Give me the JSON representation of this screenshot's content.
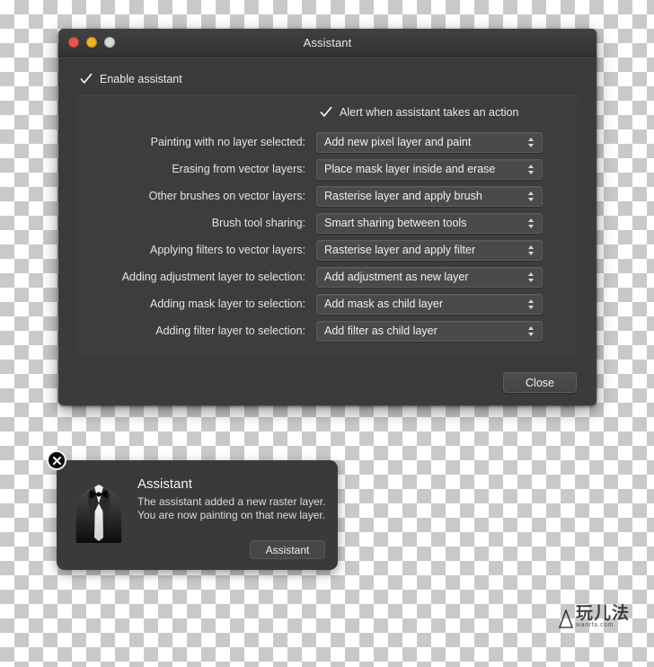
{
  "window": {
    "title": "Assistant",
    "traffic_lights": {
      "close": "close-button",
      "minimize": "minimize-button",
      "zoom": "zoom-button"
    },
    "enable_checkbox": {
      "label": "Enable assistant",
      "checked": true
    },
    "alert_checkbox": {
      "label": "Alert when assistant takes an action",
      "checked": true
    },
    "settings": [
      {
        "label": "Painting with no layer selected:",
        "value": "Add new pixel layer and paint"
      },
      {
        "label": "Erasing from vector layers:",
        "value": "Place mask layer inside and erase"
      },
      {
        "label": "Other brushes on vector layers:",
        "value": "Rasterise layer and apply brush"
      },
      {
        "label": "Brush tool sharing:",
        "value": "Smart sharing between tools"
      },
      {
        "label": "Applying filters to vector layers:",
        "value": "Rasterise layer and apply filter"
      },
      {
        "label": "Adding adjustment layer to selection:",
        "value": "Add adjustment as new layer"
      },
      {
        "label": "Adding mask layer to selection:",
        "value": "Add mask as child layer"
      },
      {
        "label": "Adding filter layer to selection:",
        "value": "Add filter as child layer"
      }
    ],
    "close_button": "Close"
  },
  "toast": {
    "title": "Assistant",
    "line1": "The assistant added a new raster layer.",
    "line2": "You are now painting on that new layer.",
    "button": "Assistant",
    "close_icon": "close-icon",
    "avatar_icon": "tuxedo-icon"
  },
  "watermark": {
    "text": "玩儿法",
    "url": "wanrfa.com"
  },
  "colors": {
    "window_bg": "#3b3b3b",
    "titlebar": "#3a3a3a",
    "field_bg": "#4a4a4a",
    "text": "#eaeaea",
    "traffic_close": "#e8564a",
    "traffic_min": "#f0b429",
    "traffic_zoom": "#d8d8d8"
  }
}
